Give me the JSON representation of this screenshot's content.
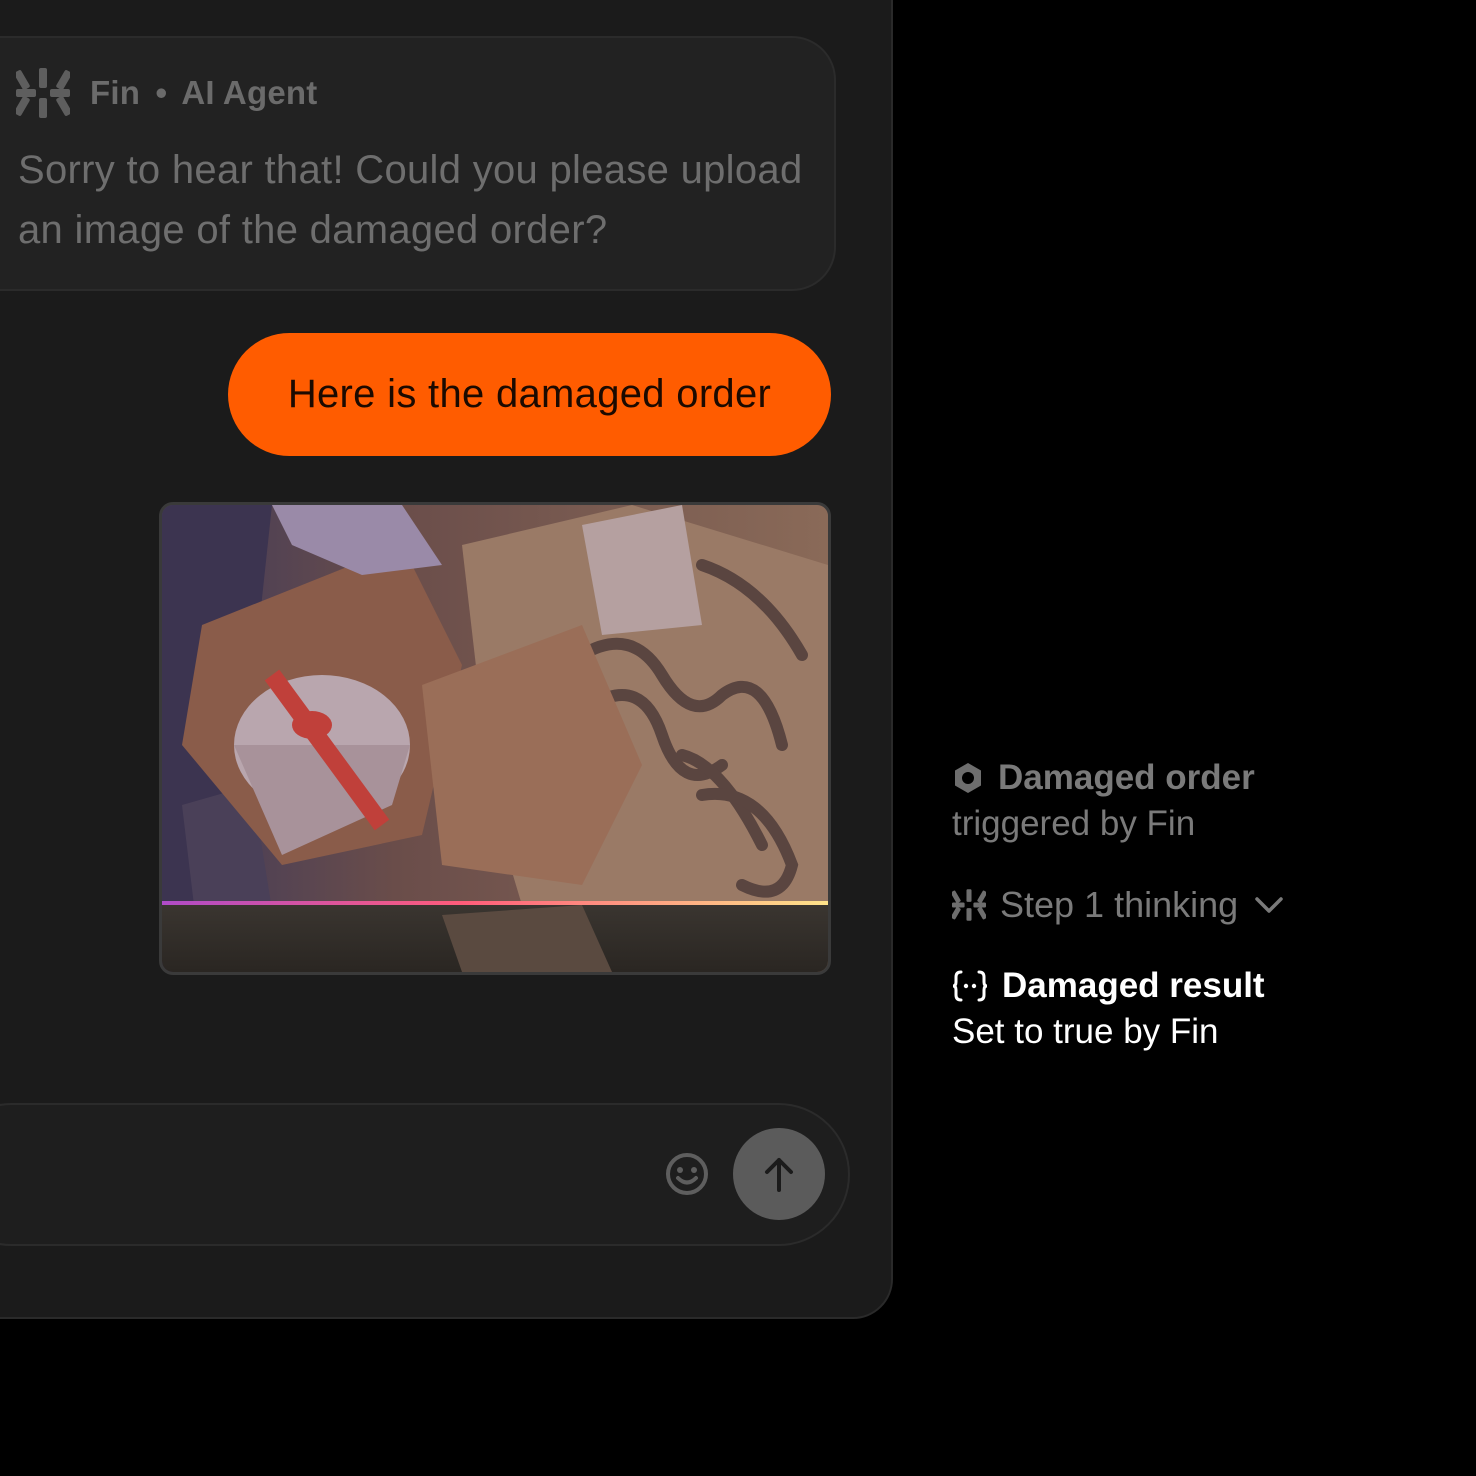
{
  "conversation": {
    "agent_message": {
      "sender": "Fin",
      "separator": "•",
      "role": "AI Agent",
      "text": "Sorry to hear that! Could you please upload an image of the damaged order?",
      "icon": "fin-logo-icon"
    },
    "user_message": {
      "text": "Here is the damaged order",
      "color": "#ff5c00"
    },
    "attachment": {
      "description_icon": "damaged-order-photo"
    }
  },
  "composer": {
    "emoji_icon": "smiley-icon",
    "send_icon": "arrow-up-icon"
  },
  "events": {
    "trigger": {
      "icon": "hexagon-icon",
      "title": "Damaged order",
      "subtitle": "triggered by Fin"
    },
    "step": {
      "icon": "fin-logo-icon",
      "label": "Step 1 thinking",
      "chevron": "chevron-down-icon"
    },
    "result": {
      "icon": "braces-icon",
      "title": "Damaged result",
      "subtitle": "Set to true by Fin"
    }
  },
  "colors": {
    "background": "#000000",
    "panel": "#1b1b1b",
    "accent": "#ff5c00",
    "muted_text": "#6e6e6e"
  }
}
